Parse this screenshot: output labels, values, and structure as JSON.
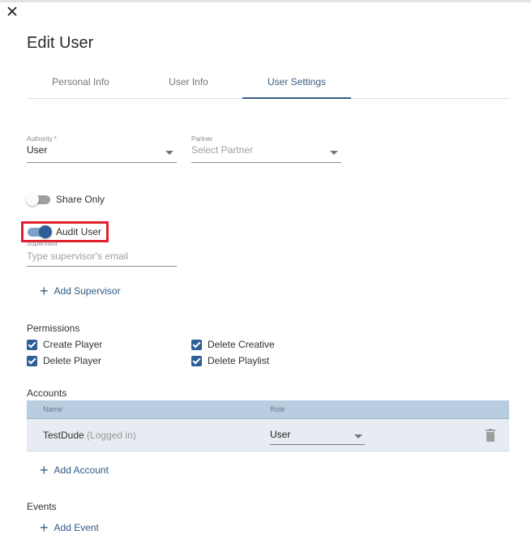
{
  "dialog": {
    "title": "Edit User",
    "close_icon": "close-icon"
  },
  "tabs": [
    {
      "label": "Personal Info",
      "active": false
    },
    {
      "label": "User Info",
      "active": false
    },
    {
      "label": "User Settings",
      "active": true
    }
  ],
  "fields": {
    "authority": {
      "label": "Authority *",
      "value": "User"
    },
    "partner": {
      "label": "Partner",
      "placeholder": "Select Partner"
    },
    "supervisor": {
      "label": "Supervisor",
      "placeholder": "Type supervisor's email"
    }
  },
  "toggles": {
    "share_only": {
      "label": "Share Only",
      "on": false
    },
    "audit_user": {
      "label": "Audit User",
      "on": true,
      "highlighted": true
    }
  },
  "buttons": {
    "add_supervisor": "Add Supervisor",
    "add_account": "Add Account",
    "add_event": "Add Event"
  },
  "permissions": {
    "title": "Permissions",
    "items": [
      {
        "label": "Create Player",
        "checked": true
      },
      {
        "label": "Delete Creative",
        "checked": true
      },
      {
        "label": "Delete Player",
        "checked": true
      },
      {
        "label": "Delete Playlist",
        "checked": true
      }
    ]
  },
  "accounts": {
    "title": "Accounts",
    "columns": [
      "Name",
      "Role"
    ],
    "rows": [
      {
        "name": "TestDude",
        "note": "(Logged in)",
        "role": "User"
      }
    ]
  },
  "events": {
    "title": "Events"
  },
  "colors": {
    "accent": "#3b5f84",
    "toggle_on": "#2c5f96",
    "highlight_box": "#e0202a",
    "table_header": "#b9cde0",
    "table_row": "#e6ecf2"
  }
}
